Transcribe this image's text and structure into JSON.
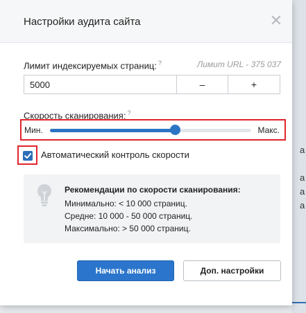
{
  "background": {
    "right_edge_glyphs": [
      "а",
      "а",
      "а",
      "а"
    ]
  },
  "dialog": {
    "title": "Настройки аудита сайта",
    "close_symbol": "✕"
  },
  "limit": {
    "label": "Лимит индексируемых страниц:",
    "help_mark": "?",
    "url_limit_text": "Лимит URL - 375 037",
    "value": "5000",
    "minus_label": "–",
    "plus_label": "+"
  },
  "speed": {
    "label": "Скорость сканирования:",
    "help_mark": "?",
    "min_label": "Мин.",
    "max_label": "Макс.",
    "level_fraction": 0.62
  },
  "auto_control": {
    "checked": true,
    "label": "Автоматический контроль скорости"
  },
  "recommendations": {
    "title": "Рекомендации по скорости сканирования:",
    "lines": [
      "Минимально: < 10 000 страниц.",
      "Средне: 10 000 - 50 000 страниц.",
      "Максимально: > 50 000 страниц."
    ]
  },
  "buttons": {
    "start": "Начать анализ",
    "more_settings": "Доп. настройки"
  },
  "colors": {
    "accent": "#2b76cc",
    "highlight": "#e0242c"
  },
  "icons": {
    "bulb": "lightbulb-icon",
    "check": "checkmark-icon",
    "close": "close-icon"
  }
}
